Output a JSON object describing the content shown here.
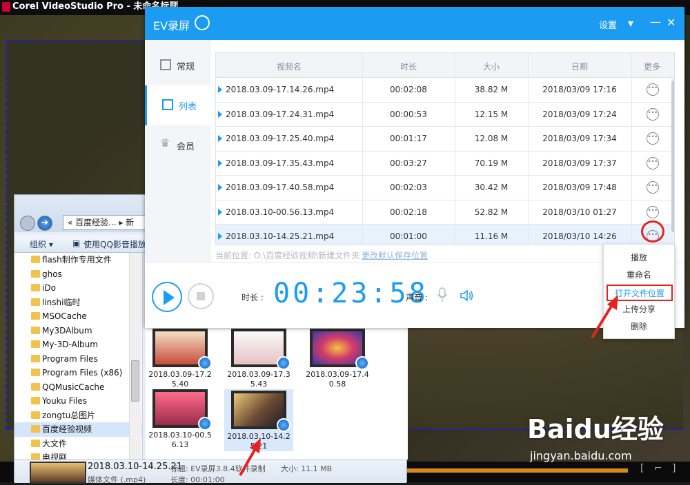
{
  "corel": {
    "title": "Corel VideoStudio Pro - 未命名标题"
  },
  "explorer": {
    "address": "« 百度经验... ▸ 新",
    "toolbar": {
      "organize": "组织 ▾",
      "play_with": "使用QQ影音播放"
    },
    "tree": [
      "flash制作专用文件",
      "ghos",
      "iDo",
      "linshi临时",
      "MSOCache",
      "My3DAlbum",
      "My-3D-Album",
      "Program Files",
      "Program Files (x86)",
      "QQMusicCache",
      "Youku Files",
      "zongtu总图片",
      "百度经验视频",
      "大文件",
      "电视剧"
    ],
    "tree_selected_index": 12,
    "files": [
      {
        "name_line1": "2018.03.09-17.2",
        "name_line2": "5.40"
      },
      {
        "name_line1": "2018.03.09-17.3",
        "name_line2": "5.43"
      },
      {
        "name_line1": "2018.03.09-17.4",
        "name_line2": "0.58"
      },
      {
        "name_line1": "2018.03.10-00.5",
        "name_line2": "6.13"
      },
      {
        "name_line1": "2018.03.10-14.2",
        "name_line2": "5.21"
      }
    ],
    "status": {
      "filename": "2018.03.10-14.25.21",
      "type": "媒体文件 (.mp4)",
      "title": "标题: EV录屏3.8.4软件录制",
      "length": "长度: 00:01:00",
      "size": "大小: 11.1 MB"
    }
  },
  "ev": {
    "title": "EV录屏",
    "settings": "设置",
    "controls": {
      "dropdown": "▾",
      "minimize": "—",
      "close": "✕"
    },
    "sidebar": [
      {
        "label": "常规",
        "active": false
      },
      {
        "label": "列表",
        "active": true
      },
      {
        "label": "会员",
        "active": false
      }
    ],
    "table": {
      "headers": [
        "视频名",
        "时长",
        "大小",
        "日期",
        "更多"
      ],
      "rows": [
        {
          "name": "2018.03.09-17.14.26.mp4",
          "duration": "00:02:08",
          "size": "38.82 M",
          "date": "2018/03/09 17:16"
        },
        {
          "name": "2018.03.09-17.24.31.mp4",
          "duration": "00:00:53",
          "size": "12.15 M",
          "date": "2018/03/09 17:24"
        },
        {
          "name": "2018.03.09-17.25.40.mp4",
          "duration": "00:01:17",
          "size": "12.08 M",
          "date": "2018/03/09 17:34"
        },
        {
          "name": "2018.03.09-17.35.43.mp4",
          "duration": "00:03:27",
          "size": "70.19 M",
          "date": "2018/03/09 17:37"
        },
        {
          "name": "2018.03.09-17.40.58.mp4",
          "duration": "00:02:03",
          "size": "30.42 M",
          "date": "2018/03/09 17:48"
        },
        {
          "name": "2018.03.10-00.56.13.mp4",
          "duration": "00:02:18",
          "size": "52.82 M",
          "date": "2018/03/10 01:27"
        },
        {
          "name": "2018.03.10-14.25.21.mp4",
          "duration": "00:01:00",
          "size": "11.16 M",
          "date": "2018/03/10 14:26"
        }
      ],
      "selected_row": 6,
      "more_glyph": "•••"
    },
    "save_location": "当前位置: O:\\百度经验视频\\新建文件夹",
    "change_save": "更改默认保存位置",
    "bottom": {
      "duration_label": "时长 :",
      "duration_value": "00:23:58",
      "volume_label": "声音 :"
    },
    "context_menu": [
      {
        "label": "播放",
        "highlight": false
      },
      {
        "label": "重命名",
        "highlight": false
      },
      {
        "label": "打开文件位置",
        "highlight": true
      },
      {
        "label": "上传分享",
        "highlight": false
      },
      {
        "label": "删除",
        "highlight": false
      }
    ]
  },
  "watermark": {
    "brand": "Baidu经验",
    "url": "jingyan.baidu.com"
  },
  "colors": {
    "accent": "#1b9cf2",
    "annotation": "#e52222"
  }
}
